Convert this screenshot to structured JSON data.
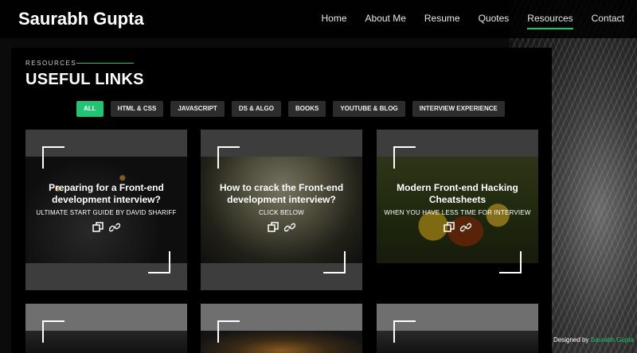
{
  "brand": "Saurabh Gupta",
  "nav": [
    "Home",
    "About Me",
    "Resume",
    "Quotes",
    "Resources",
    "Contact"
  ],
  "nav_active": "Resources",
  "section": {
    "tag": "RESOURCES",
    "title": "USEFUL LINKS"
  },
  "filters": [
    "ALL",
    "HTML & CSS",
    "JAVASCRIPT",
    "DS & ALGO",
    "BOOKS",
    "YOUTUBE & BLOG",
    "INTERVIEW EXPERIENCE"
  ],
  "filter_active": "ALL",
  "cards": [
    {
      "title": "Preparing for a Front-end development interview?",
      "subtitle": "ULTIMATE START GUIDE BY DAVID SHARIFF"
    },
    {
      "title": "How to crack the Front-end development interview?",
      "subtitle": "CLICK BELOW"
    },
    {
      "title": "Modern Front-end Hacking Cheatsheets",
      "subtitle": "WHEN YOU HAVE LESS TIME FOR INTERVIEW"
    }
  ],
  "footer": {
    "credit_prefix": "Designed by",
    "credit_name": "Saurabh Gupta"
  },
  "colors": {
    "accent": "#20c472",
    "panel": "#000000",
    "filter_bg": "#2c2c2c"
  }
}
